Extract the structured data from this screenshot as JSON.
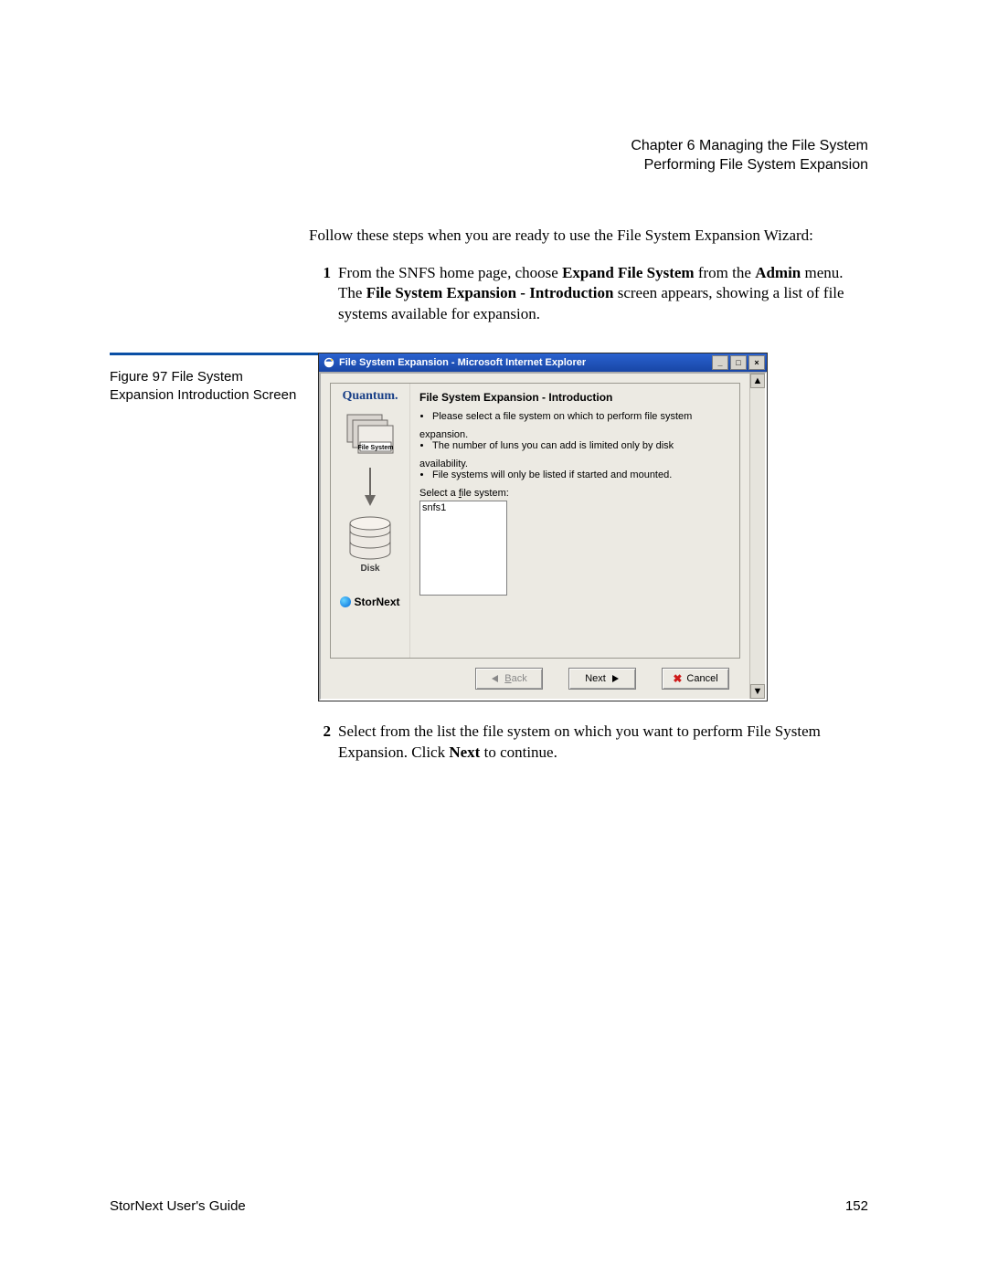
{
  "header": {
    "chapter": "Chapter 6  Managing the File System",
    "section": "Performing File System Expansion"
  },
  "intro_text": "Follow these steps when you are ready to use the File System Expansion Wizard:",
  "step1": {
    "num": "1",
    "pre": "From the SNFS home page, choose ",
    "bold1": "Expand File System",
    "mid1": " from the ",
    "bold2": "Admin",
    "mid2": " menu. The ",
    "bold3": "File System Expansion - Introduction",
    "post": " screen appears, showing a list of file systems available for expansion."
  },
  "figure": {
    "label": "Figure 97  File System Expansion Introduction Screen"
  },
  "window": {
    "title": "File System Expansion - Microsoft Internet Explorer",
    "sidebar": {
      "brand": "Quantum.",
      "fs_label": "File System",
      "disk_label": "Disk",
      "product": "StorNext"
    },
    "content": {
      "heading": "File System Expansion - Introduction",
      "bullet1": "Please select a file system on which to perform file system",
      "bullet1_cont": "expansion.",
      "bullet2": "The number of luns you can add is limited only by disk",
      "bullet2_cont": "availability.",
      "bullet3": "File systems will only be listed if started and mounted.",
      "select_label_pre": "Select a ",
      "select_label_u": "f",
      "select_label_post": "ile system:",
      "list_item": "snfs1"
    },
    "buttons": {
      "back_u": "B",
      "back_rest": "ack",
      "next": "Next",
      "cancel": "Cancel"
    }
  },
  "step2": {
    "num": "2",
    "pre": "Select from the list the file system on which you want to perform File System Expansion. Click ",
    "bold1": "Next",
    "post": " to continue."
  },
  "footer": {
    "guide": "StorNext User's Guide",
    "page": "152"
  }
}
